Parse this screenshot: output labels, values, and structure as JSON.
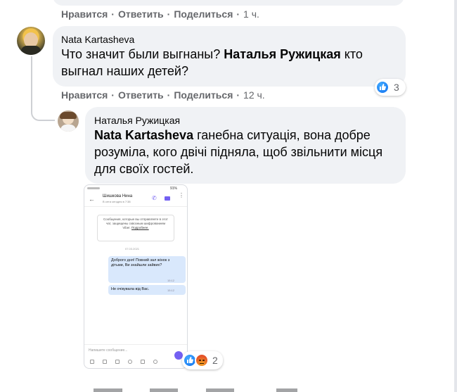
{
  "top_actions": {
    "like": "Нравится",
    "reply": "Ответить",
    "share": "Поделиться",
    "time": "1 ч."
  },
  "comment1": {
    "author": "Nata Kartasheva",
    "text_before": "Что значит были выгнаны? ",
    "mention": "Наталья Ружицкая",
    "text_after": " кто выгнал наших детей?",
    "reactions_count": "3",
    "actions": {
      "like": "Нравится",
      "reply": "Ответить",
      "share": "Поделиться",
      "time": "12 ч."
    }
  },
  "comment2": {
    "author": "Наталья Ружицкая",
    "mention": "Nata Kartasheva",
    "text_after": " ганебна ситуація, вона добре розуміла, кого двічі підняла, щоб звільнити місця для своїх гостей.",
    "reactions_count": "2",
    "screenshot": {
      "status_time": "",
      "status_right": "91%",
      "contact_name": "Шишкова Нина",
      "contact_status": "В сети сегодня в 7:38",
      "encryption_notice": "Сообщения, которые вы отправляете в этот чат, защищены сквозным шифрованием Viber.",
      "encryption_link": "Подробнее.",
      "date": "07.03.2021",
      "message1": "Доброго дня! Повний зал жінок з дітьми, Ви знайшли зайвих?",
      "message1_time": "15:12",
      "message2": "Не очікувала від Вас.",
      "message2_time": "15:12",
      "input_placeholder": "Напишите сообщение..."
    }
  },
  "colors": {
    "accent": "#1877f2",
    "meta": "#65676b",
    "bubble": "#f0f2f5"
  },
  "icons": [
    "like-reaction-icon",
    "angry-reaction-icon",
    "phone-icon",
    "video-call-icon",
    "more-options-icon",
    "back-arrow-icon",
    "send-icon"
  ]
}
